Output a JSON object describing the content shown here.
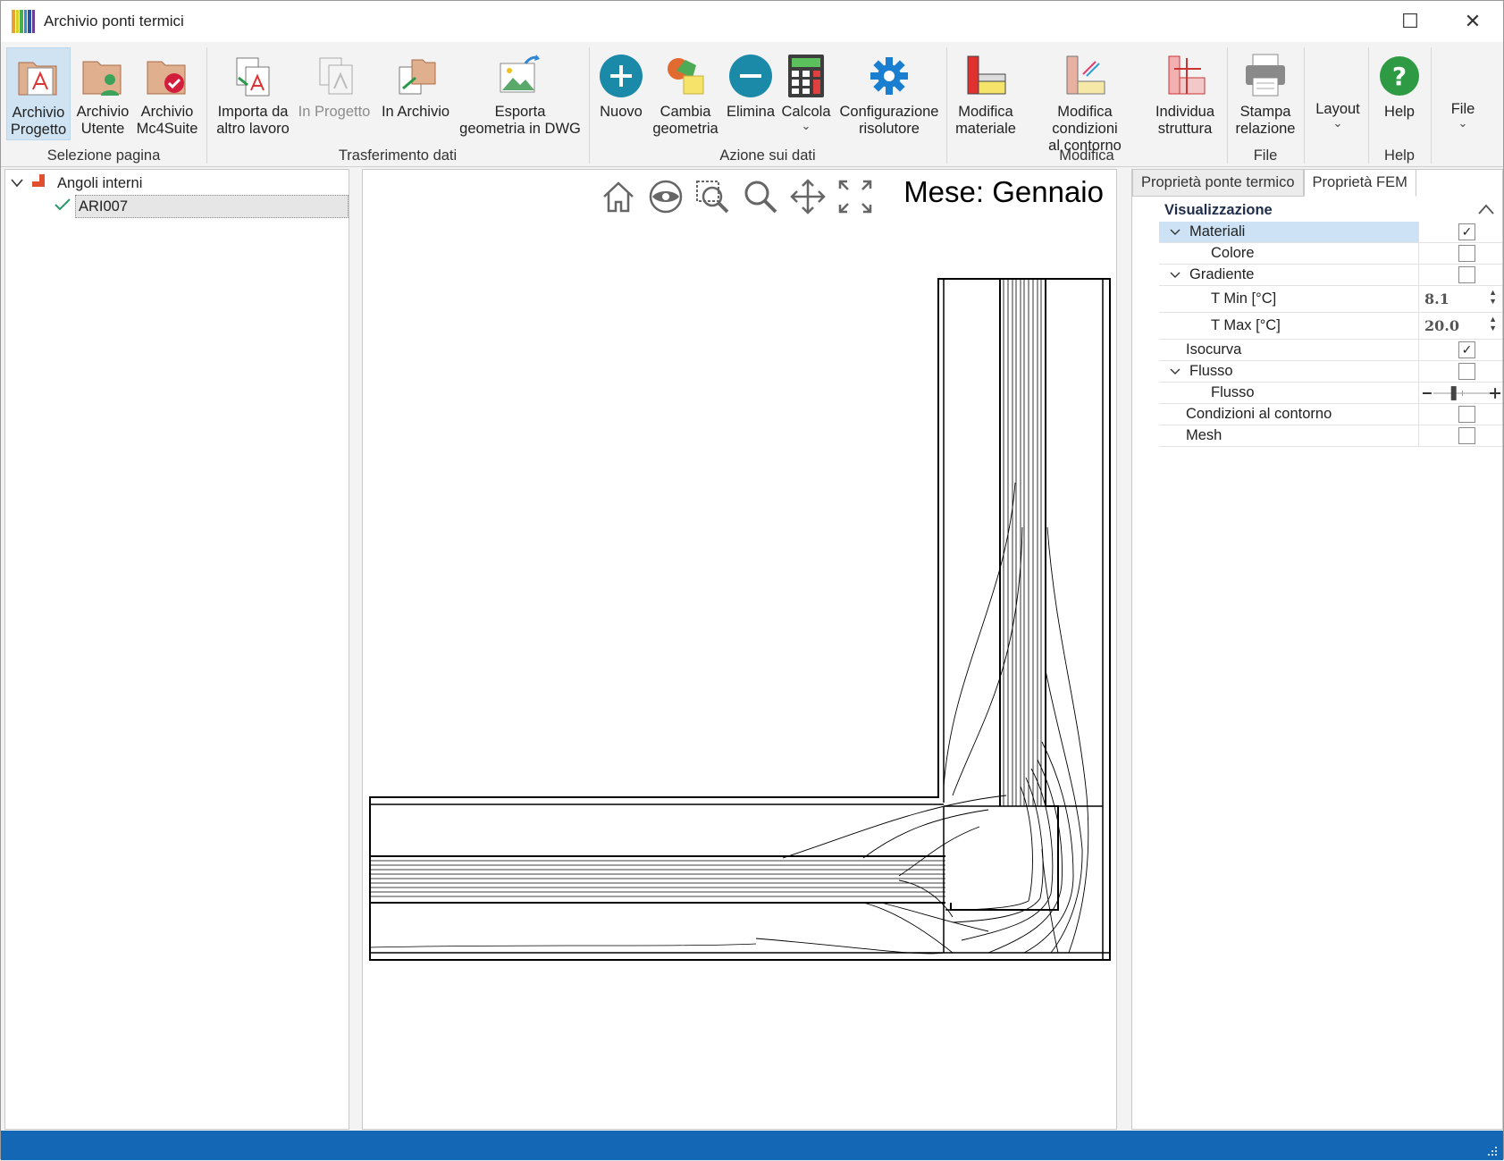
{
  "window": {
    "title": "Archivio ponti termici",
    "icon_colors": [
      "#e8a12a",
      "#d9d126",
      "#49b04c",
      "#2f8fcf",
      "#2554a5",
      "#6e3d8f"
    ],
    "maximize_icon": "☐",
    "close_icon": "✕"
  },
  "ribbon": {
    "archivio_progetto": "Archivio\nProgetto",
    "archivio_utente": "Archivio\nUtente",
    "archivio_mc4suite": "Archivio\nMc4Suite",
    "importa": "Importa da\naltro lavoro",
    "in_progetto": "In Progetto",
    "in_archivio": "In Archivio",
    "esporta": "Esporta\ngeometria in DWG",
    "nuovo": "Nuovo",
    "cambia": "Cambia\ngeometria",
    "elimina": "Elimina",
    "calcola": "Calcola",
    "configurazione": "Configurazione\nrisolutore",
    "modifica_materiale": "Modifica\nmateriale",
    "modifica_condizioni": "Modifica condizioni\nal contorno",
    "individua": "Individua\nstruttura",
    "stampa": "Stampa\nrelazione",
    "layout": "Layout",
    "help": "Help",
    "file": "File",
    "chevron": "⌄",
    "groups": {
      "selezione": "Selezione pagina",
      "trasferimento": "Trasferimento dati",
      "azione": "Azione sui dati",
      "modifica": "Modifica",
      "file": "File",
      "help": "Help"
    }
  },
  "tree": {
    "root": "Angoli interni",
    "child": "ARI007"
  },
  "canvas": {
    "month": "Mese: Gennaio"
  },
  "properties": {
    "tabs": [
      "Proprietà ponte termico",
      "Proprietà FEM"
    ],
    "section": "Visualizzazione",
    "rows": {
      "materiali": "Materiali",
      "colore": "Colore",
      "gradiente": "Gradiente",
      "tmin_label": "T Min [°C]",
      "tmin_value": "8.1",
      "tmax_label": "T Max [°C]",
      "tmax_value": "20.0",
      "isocurva": "Isocurva",
      "flusso": "Flusso",
      "flusso_sub": "Flusso",
      "condizioni": "Condizioni al contorno",
      "mesh": "Mesh"
    },
    "checks": {
      "materiali": true,
      "colore": false,
      "gradiente": false,
      "isocurva": true,
      "flusso": false,
      "condizioni": false,
      "mesh": false
    },
    "flusso_slider_level": 0.35
  },
  "colors": {
    "accent": "#1467b5",
    "selection": "#cde3f5"
  }
}
